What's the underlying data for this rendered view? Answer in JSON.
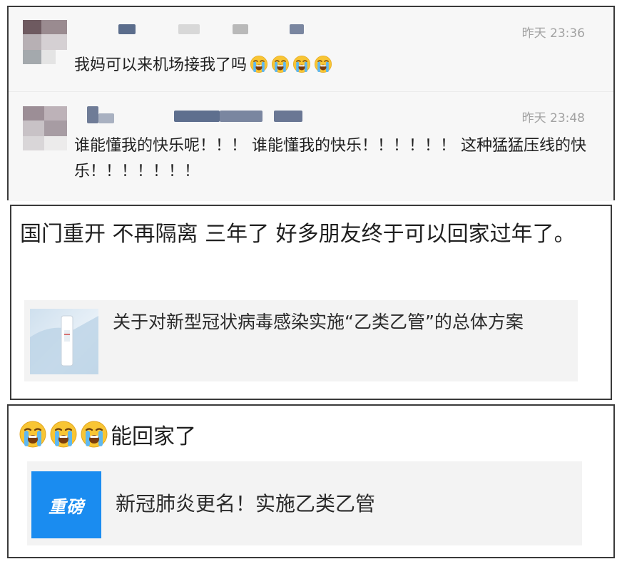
{
  "comments": [
    {
      "time": "昨天 23:36",
      "text": "我妈可以来机场接我了吗",
      "emojis": [
        "loudly-crying-face",
        "loudly-crying-face",
        "loudly-crying-face",
        "loudly-crying-face"
      ]
    },
    {
      "time": "昨天 23:48",
      "text": "谁能懂我的快乐呢！！！ 谁能懂我的快乐！！！！！！ 这种猛猛压线的快乐！！！！！！！"
    }
  ],
  "post1": {
    "text": "国门重开 不再隔离 三年了 好多朋友终于可以回家过年了。",
    "card_title": "关于对新型冠状病毒感染实施“乙类乙管”的总体方案"
  },
  "post2": {
    "emojis": [
      "loudly-crying-face",
      "loudly-crying-face",
      "loudly-crying-face"
    ],
    "text": "能回家了",
    "thumb_label": "重磅",
    "card_title": "新冠肺炎更名！实施乙类乙管"
  },
  "colors": {
    "panel_border": "#3a3a3a",
    "comment_bg": "#f7f7f7",
    "card_bg": "#f3f3f3",
    "time_text": "#a2a2a2",
    "brand_blue": "#1a8cf0"
  }
}
